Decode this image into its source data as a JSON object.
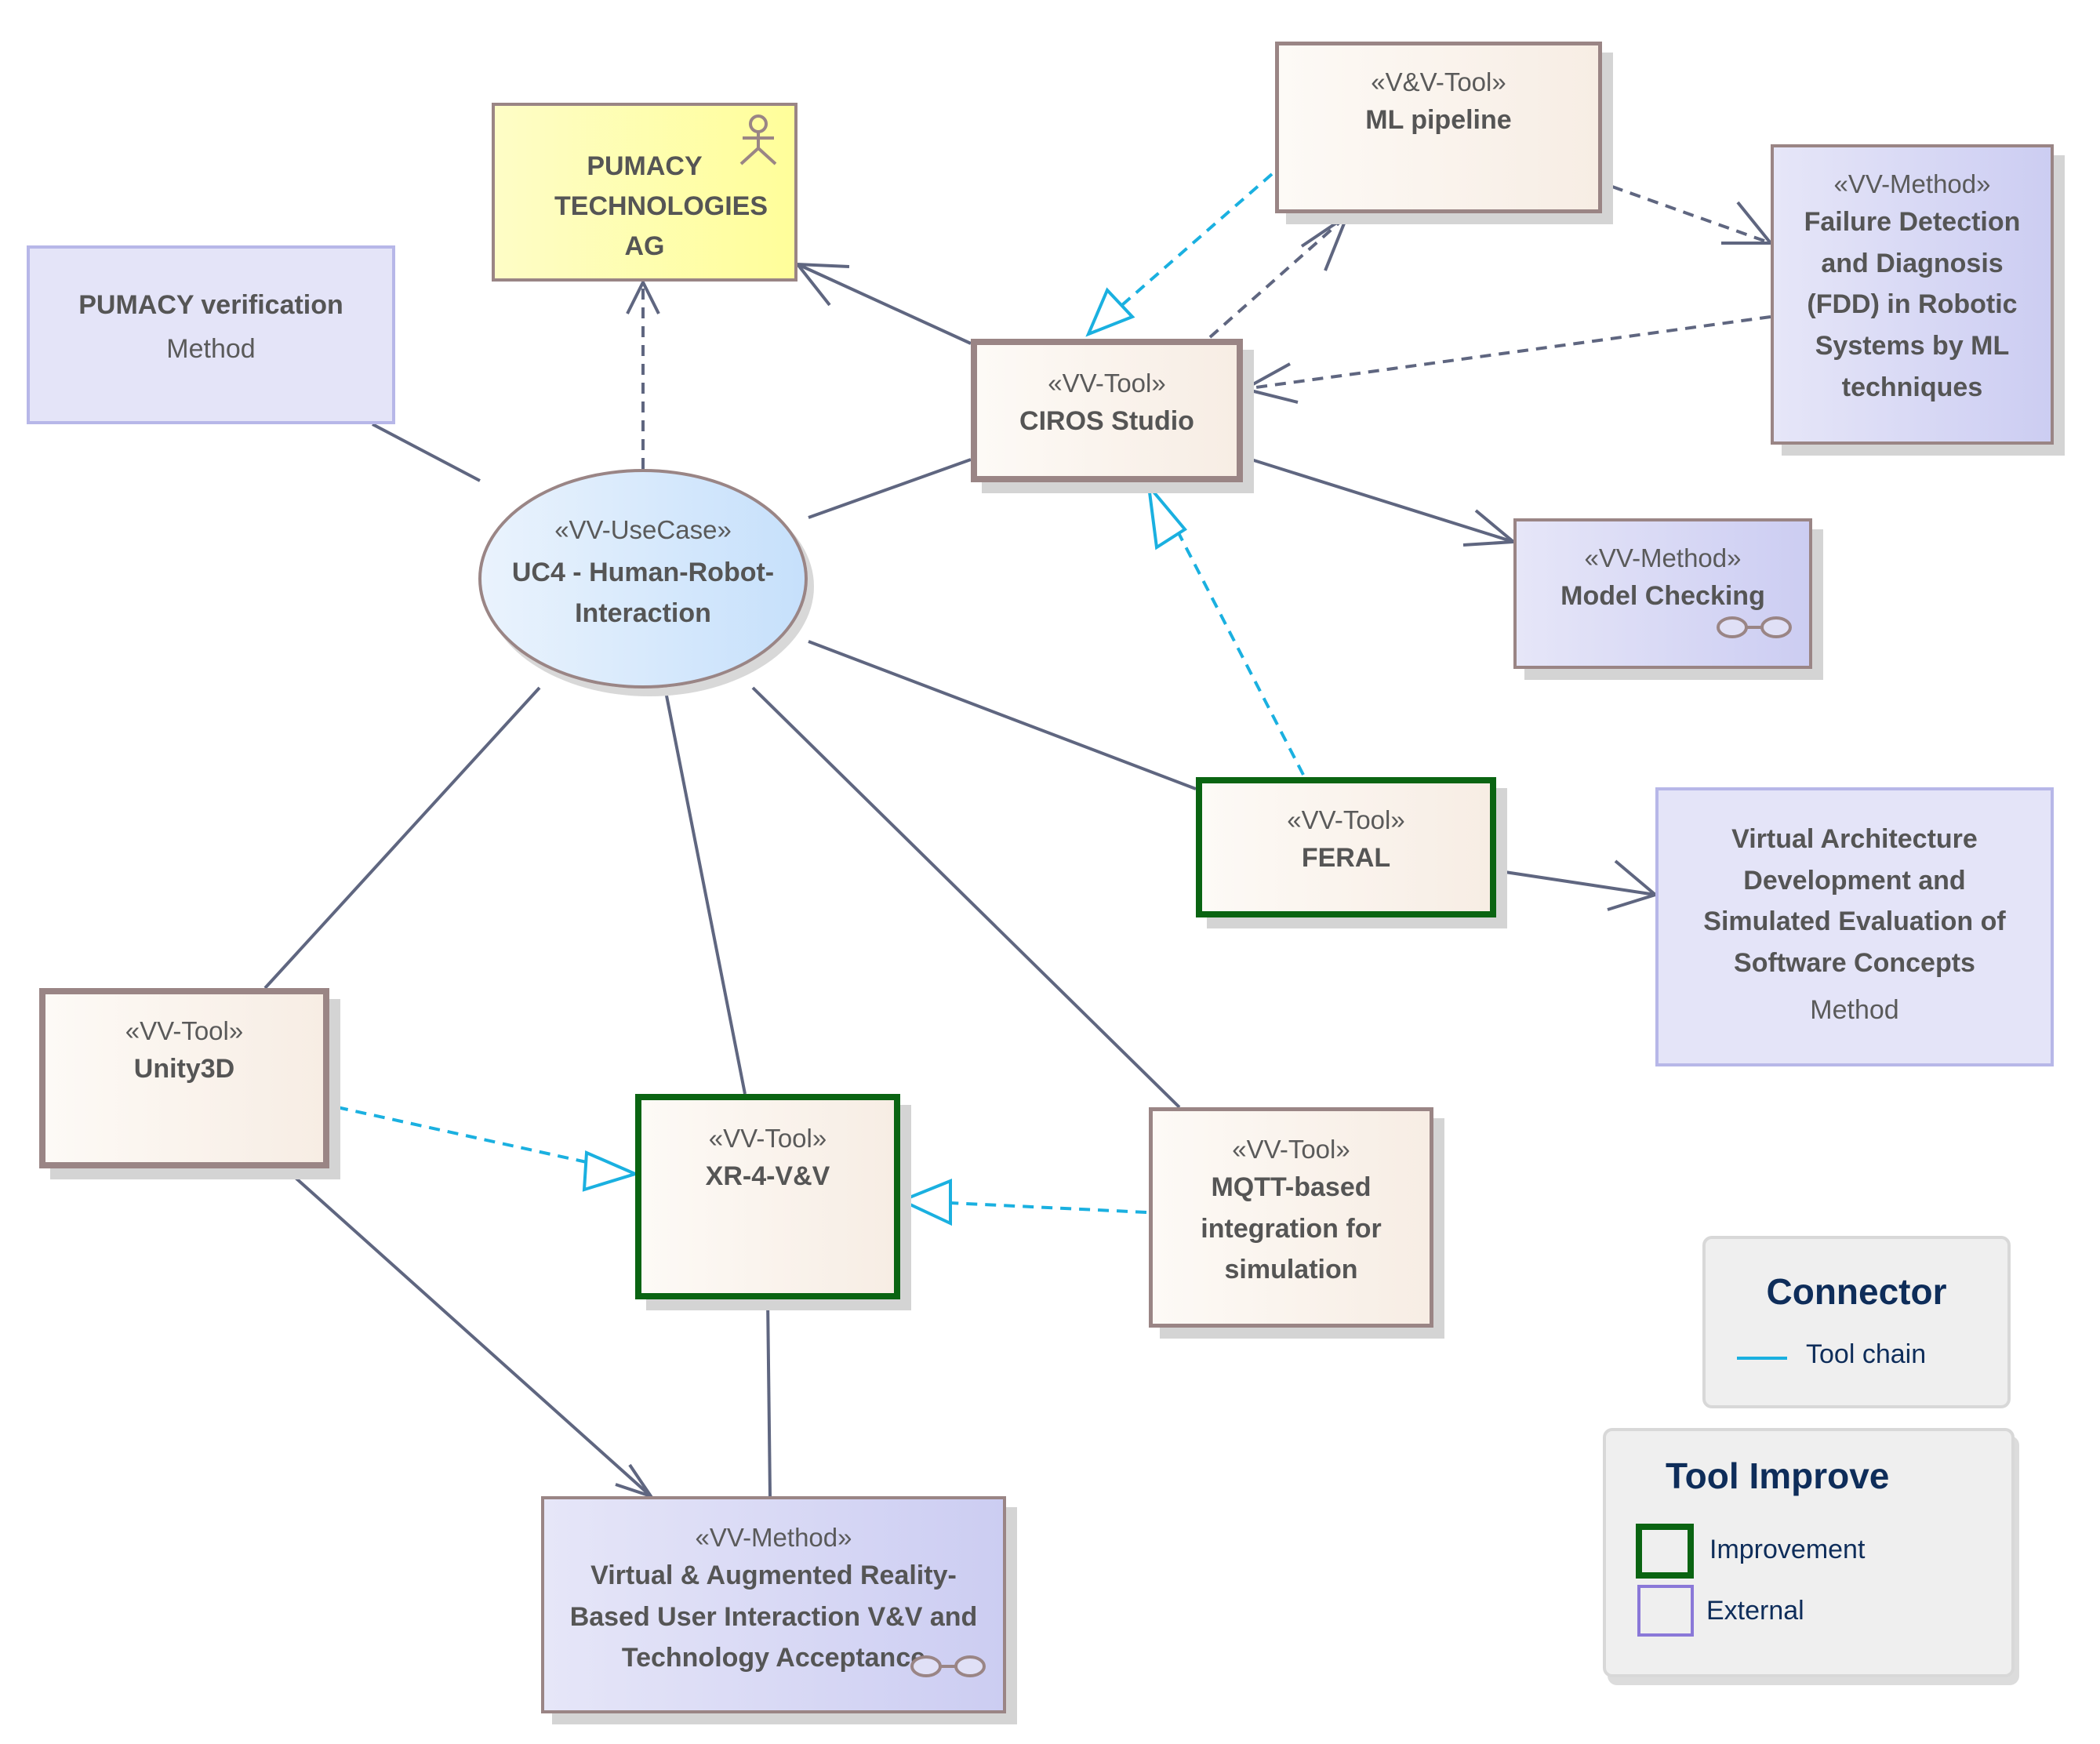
{
  "diagram": {
    "actor": {
      "name": "PUMACY TECHNOLOGIES AG",
      "icon": "actor-stick-figure-icon"
    },
    "use_case": {
      "stereotype": "«VV-UseCase»",
      "name_line1": "UC4 - Human-Robot-",
      "name_line2": "Interaction"
    },
    "external_methods": [
      {
        "id": "pumacy-verification",
        "name": "PUMACY verification",
        "kind": "Method"
      },
      {
        "id": "virtual-architecture",
        "name_lines": [
          "Virtual Architecture",
          "Development and",
          "Simulated Evaluation of",
          "Software Concepts"
        ],
        "kind": "Method"
      }
    ],
    "tools": [
      {
        "id": "ml-pipeline",
        "stereotype": "«V&V-Tool»",
        "name_lines": [
          "ML pipeline"
        ]
      },
      {
        "id": "ciros-studio",
        "stereotype": "«VV-Tool»",
        "name_lines": [
          "CIROS Studio"
        ]
      },
      {
        "id": "feral",
        "stereotype": "«VV-Tool»",
        "name_lines": [
          "FERAL"
        ],
        "status": "Improvement"
      },
      {
        "id": "unity3d",
        "stereotype": "«VV-Tool»",
        "name_lines": [
          "Unity3D"
        ]
      },
      {
        "id": "xr-4-vv",
        "stereotype": "«VV-Tool»",
        "name_lines": [
          "XR-4-V&V"
        ],
        "status": "Improvement"
      },
      {
        "id": "mqtt",
        "stereotype": "«VV-Tool»",
        "name_lines": [
          "MQTT-based",
          "integration for",
          "simulation"
        ]
      }
    ],
    "methods": [
      {
        "id": "fdd",
        "stereotype": "«VV-Method»",
        "name_lines": [
          "Failure Detection",
          "and Diagnosis",
          "(FDD) in Robotic",
          "Systems by ML",
          "techniques"
        ]
      },
      {
        "id": "model-checking",
        "stereotype": "«VV-Method»",
        "name_lines": [
          "Model Checking"
        ],
        "icon": "glasses-icon"
      },
      {
        "id": "vr-ar-method",
        "stereotype": "«VV-Method»",
        "name_lines": [
          "Virtual & Augmented Reality-",
          "Based User Interaction V&V and",
          "Technology Acceptance"
        ],
        "icon": "glasses-icon"
      }
    ],
    "connections": [
      {
        "from": "use-case",
        "to": "actor",
        "type": "dependency"
      },
      {
        "from": "use-case",
        "to": "pumacy-verification",
        "type": "association"
      },
      {
        "from": "use-case",
        "to": "ciros-studio",
        "type": "association"
      },
      {
        "from": "use-case",
        "to": "feral",
        "type": "association"
      },
      {
        "from": "use-case",
        "to": "unity3d",
        "type": "association"
      },
      {
        "from": "use-case",
        "to": "xr-4-vv",
        "type": "association"
      },
      {
        "from": "use-case",
        "to": "mqtt",
        "type": "association"
      },
      {
        "from": "ciros-studio",
        "to": "actor",
        "type": "directed-association"
      },
      {
        "from": "ciros-studio",
        "to": "ml-pipeline",
        "type": "dependency"
      },
      {
        "from": "ml-pipeline",
        "to": "ciros-studio",
        "type": "tool-chain"
      },
      {
        "from": "ml-pipeline",
        "to": "fdd",
        "type": "dependency"
      },
      {
        "from": "fdd",
        "to": "ciros-studio",
        "type": "dependency"
      },
      {
        "from": "ciros-studio",
        "to": "model-checking",
        "type": "directed-association"
      },
      {
        "from": "feral",
        "to": "ciros-studio",
        "type": "tool-chain"
      },
      {
        "from": "feral",
        "to": "virtual-architecture",
        "type": "directed-association"
      },
      {
        "from": "unity3d",
        "to": "xr-4-vv",
        "type": "tool-chain"
      },
      {
        "from": "mqtt",
        "to": "xr-4-vv",
        "type": "tool-chain"
      },
      {
        "from": "unity3d",
        "to": "vr-ar-method",
        "type": "directed-association"
      },
      {
        "from": "xr-4-vv",
        "to": "vr-ar-method",
        "type": "association"
      }
    ]
  },
  "legends": {
    "connector": {
      "title": "Connector",
      "items": [
        {
          "label": "Tool chain",
          "color": "#1ab0e0"
        }
      ]
    },
    "tool_improve": {
      "title": "Tool Improve",
      "items": [
        {
          "label": "Improvement",
          "color": "#0a6412"
        },
        {
          "label": "External",
          "color": "#8a78d8"
        }
      ]
    }
  },
  "colors": {
    "line": "#5f6680",
    "toolchain": "#1ab0e0",
    "improvement": "#0a6412",
    "external_border": "#b7b7e8"
  }
}
